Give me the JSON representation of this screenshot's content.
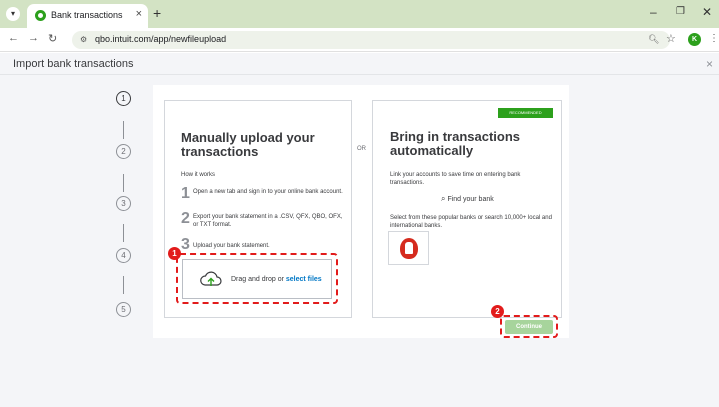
{
  "browser": {
    "tab_title": "Bank transactions",
    "tab_close": "×",
    "new_tab": "+",
    "url": "qbo.intuit.com/app/newfileupload",
    "avatar_letter": "K",
    "min": "–",
    "max": "❐",
    "close": "✕"
  },
  "page": {
    "title": "Import bank transactions",
    "close": "×"
  },
  "stepper": [
    "1",
    "2",
    "3",
    "4",
    "5"
  ],
  "manual": {
    "title": "Manually upload your transactions",
    "how": "How it works",
    "steps": [
      {
        "num": "1",
        "text": "Open a new tab and sign in to your online bank account."
      },
      {
        "num": "2",
        "text": "Export your bank statement in a .CSV, QFX, QBO, OFX, or TXT format."
      },
      {
        "num": "3",
        "text": "Upload your bank statement."
      }
    ],
    "drop_text": "Drag and drop or ",
    "drop_link": "select files"
  },
  "or_label": "OR",
  "automatic": {
    "badge": "RECOMMENDED",
    "title": "Bring in transactions automatically",
    "link_text": "Link your accounts to save time on entering bank transactions.",
    "find_bank": "Find your bank",
    "select_text": "Select from these popular banks or search 10,000+ local and international banks."
  },
  "continue_label": "Continue",
  "annotations": [
    "1",
    "2"
  ],
  "colors": {
    "brand_green": "#2ca01c",
    "annotation_red": "#e21b1b",
    "link_blue": "#0077c5"
  }
}
